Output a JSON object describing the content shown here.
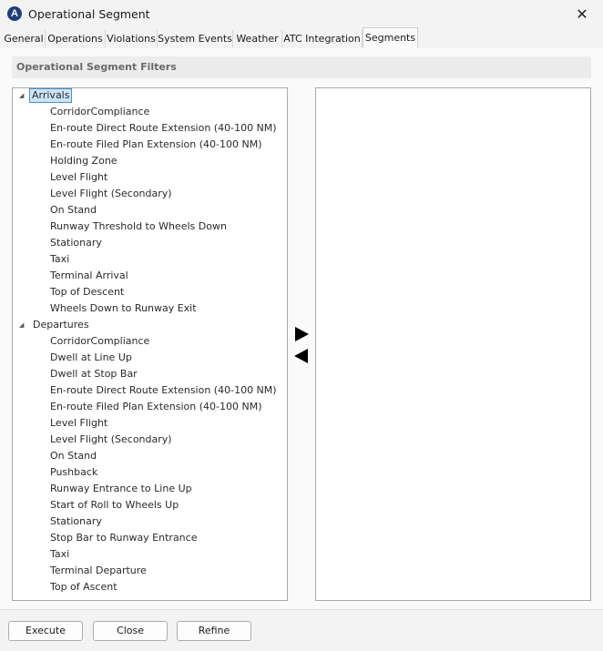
{
  "window": {
    "title": "Operational Segment",
    "close_glyph": "✕",
    "app_icon_letter": "A"
  },
  "tabs": [
    {
      "label": "General"
    },
    {
      "label": "Operations"
    },
    {
      "label": "Violations"
    },
    {
      "label": "System Events"
    },
    {
      "label": "Weather"
    },
    {
      "label": "ATC Integration"
    },
    {
      "label": "Segments",
      "active": true
    }
  ],
  "filters": {
    "header": "Operational Segment Filters",
    "groups": [
      {
        "label": "Arrivals",
        "selected": true,
        "items": [
          "CorridorCompliance",
          "En-route Direct Route Extension (40-100 NM)",
          "En-route Filed Plan Extension (40-100 NM)",
          "Holding Zone",
          "Level Flight",
          "Level Flight (Secondary)",
          "On Stand",
          "Runway Threshold to Wheels Down",
          "Stationary",
          "Taxi",
          "Terminal Arrival",
          "Top of Descent",
          "Wheels Down to Runway Exit"
        ]
      },
      {
        "label": "Departures",
        "selected": false,
        "items": [
          "CorridorCompliance",
          "Dwell at Line Up",
          "Dwell at Stop Bar",
          "En-route Direct Route Extension (40-100 NM)",
          "En-route Filed Plan Extension (40-100 NM)",
          "Level Flight",
          "Level Flight (Secondary)",
          "On Stand",
          "Pushback",
          "Runway Entrance to Line Up",
          "Start of Roll to Wheels Up",
          "Stationary",
          "Stop Bar to Runway Entrance",
          "Taxi",
          "Terminal Departure",
          "Top of Ascent"
        ]
      }
    ],
    "selected_items": []
  },
  "buttons": {
    "execute": "Execute",
    "close": "Close",
    "refine": "Refine"
  }
}
